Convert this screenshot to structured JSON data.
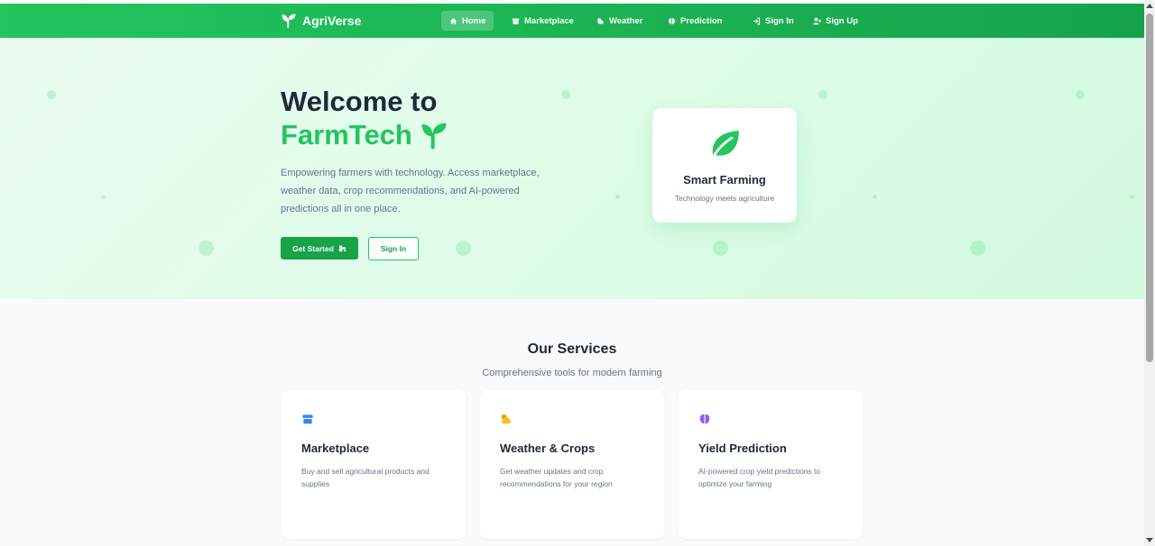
{
  "brand": {
    "name": "AgriVerse",
    "icon": "seedling-icon"
  },
  "nav": {
    "items": [
      {
        "label": "Home",
        "icon": "home-icon",
        "active": true
      },
      {
        "label": "Marketplace",
        "icon": "store-icon",
        "active": false
      },
      {
        "label": "Weather",
        "icon": "cloud-sun-icon",
        "active": false
      },
      {
        "label": "Prediction",
        "icon": "brain-icon",
        "active": false
      }
    ],
    "sign_in": "Sign In",
    "sign_up": "Sign Up"
  },
  "hero": {
    "title_line1": "Welcome to",
    "title_line2": "FarmTech",
    "description": "Empowering farmers with technology. Access marketplace, weather data, crop recommendations, and AI-powered predictions all in one place.",
    "primary_button": "Get Started",
    "secondary_button": "Sign In",
    "feature_card": {
      "title": "Smart Farming",
      "subtitle": "Technology meets agriculture",
      "icon": "leaf-icon"
    }
  },
  "services": {
    "title": "Our Services",
    "subtitle": "Comprehensive tools for modern farming",
    "cards": [
      {
        "title": "Marketplace",
        "description": "Buy and sell agricultural products and supplies",
        "icon": "store-icon"
      },
      {
        "title": "Weather & Crops",
        "description": "Get weather updates and crop recommendations for your region",
        "icon": "cloud-sun-icon"
      },
      {
        "title": "Yield Prediction",
        "description": "AI-powered crop yield predictions to optimize your farming",
        "icon": "brain-icon"
      }
    ]
  },
  "colors": {
    "primary": "#22c55e",
    "primary_dark": "#16a34a",
    "marketplace_icon": "#3b82f6",
    "weather_icon": "#f59e0b",
    "prediction_icon": "#8b5cf6"
  }
}
